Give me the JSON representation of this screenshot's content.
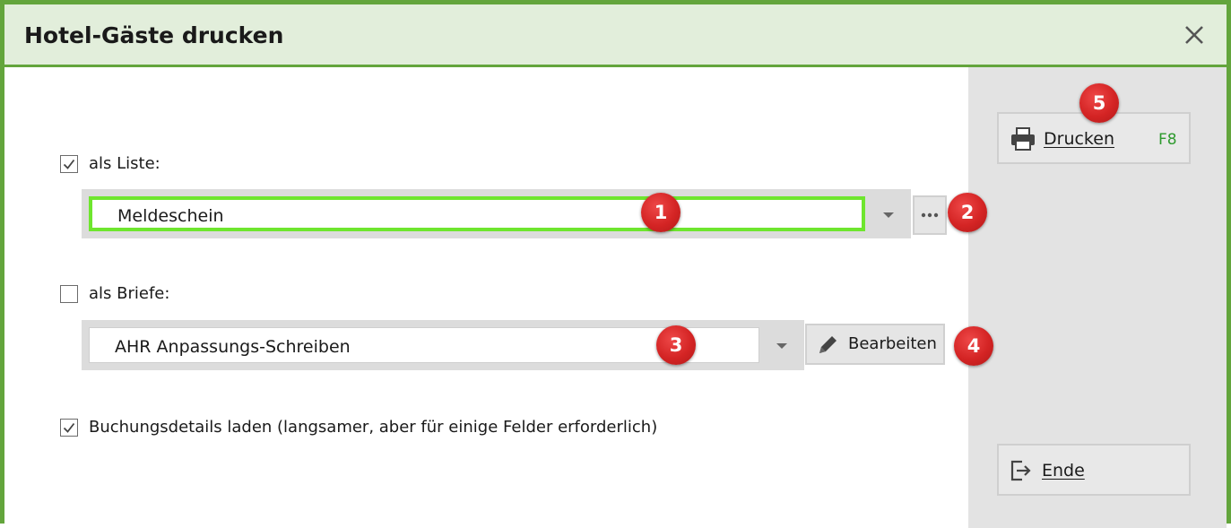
{
  "window": {
    "title": "Hotel-Gäste drucken"
  },
  "options": {
    "list": {
      "checked": true,
      "label": "als Liste:",
      "value": "Meldeschein"
    },
    "letters": {
      "checked": false,
      "label": "als Briefe:",
      "value": "AHR Anpassungs-Schreiben",
      "edit_label": "Bearbeiten"
    },
    "booking_details": {
      "checked": true,
      "label": "Buchungsdetails laden (langsamer, aber für einige Felder erforderlich)"
    }
  },
  "actions": {
    "print": {
      "label": "Drucken",
      "shortcut": "F8"
    },
    "end": {
      "label": "Ende"
    }
  },
  "markers": [
    "1",
    "2",
    "3",
    "4",
    "5"
  ],
  "colors": {
    "accent": "#63a53c",
    "focus": "#6ee62e",
    "badge": "#d42424",
    "shortcut": "#2e9a2e"
  }
}
